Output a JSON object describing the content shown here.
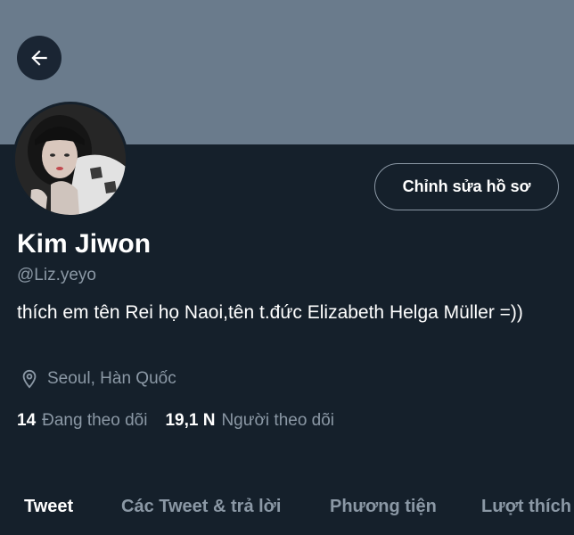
{
  "header": {
    "back_icon": "arrow-left-icon"
  },
  "profile": {
    "edit_button_label": "Chỉnh sửa hồ sơ",
    "name": "Kim Jiwon",
    "handle": "@Liz.yeyo",
    "bio": "thích em tên Rei họ Naoi,tên t.đức Elizabeth Helga Müller =))",
    "location": "Seoul, Hàn Quốc",
    "following_count": "14",
    "following_label": "Đang theo dõi",
    "followers_count": "19,1 N",
    "followers_label": "Người theo dõi"
  },
  "tabs": [
    {
      "label": "Tweet",
      "active": true
    },
    {
      "label": "Các Tweet & trả lời",
      "active": false
    },
    {
      "label": "Phương tiện",
      "active": false
    },
    {
      "label": "Lượt thích",
      "active": false
    }
  ],
  "colors": {
    "background": "#15202b",
    "banner": "#6a7b8c",
    "secondary_text": "#8b98a5",
    "primary_text": "#ffffff"
  }
}
